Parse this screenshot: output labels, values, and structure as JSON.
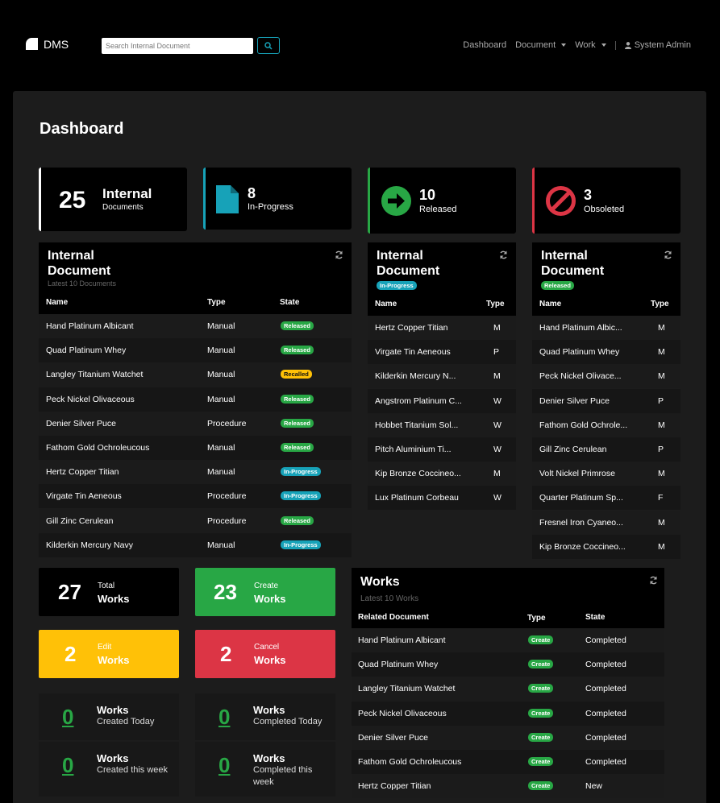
{
  "navbar": {
    "brand": "DMS",
    "search_placeholder": "Search Internal Document",
    "links": {
      "dashboard": "Dashboard",
      "document": "Document",
      "work": "Work",
      "user": "System Admin"
    }
  },
  "page_title": "Dashboard",
  "stats": [
    {
      "value": "25",
      "label1": "Internal",
      "label2": "Documents"
    },
    {
      "value": "8",
      "label": "In-Progress"
    },
    {
      "value": "10",
      "label": "Released"
    },
    {
      "value": "3",
      "label": "Obsoleted"
    }
  ],
  "internal_documents": {
    "title": "Internal Document",
    "subtitle": "Latest 10 Documents",
    "columns": [
      "Name",
      "Type",
      "State"
    ],
    "rows": [
      {
        "name": "Hand Platinum Albicant",
        "type": "Manual",
        "state": "Released"
      },
      {
        "name": "Quad Platinum Whey",
        "type": "Manual",
        "state": "Released"
      },
      {
        "name": "Langley Titanium Watchet",
        "type": "Manual",
        "state": "Recalled"
      },
      {
        "name": "Peck Nickel Olivaceous",
        "type": "Manual",
        "state": "Released"
      },
      {
        "name": "Denier Silver Puce",
        "type": "Procedure",
        "state": "Released"
      },
      {
        "name": "Fathom Gold Ochroleucous",
        "type": "Manual",
        "state": "Released"
      },
      {
        "name": "Hertz Copper Titian",
        "type": "Manual",
        "state": "In-Progress"
      },
      {
        "name": "Virgate Tin Aeneous",
        "type": "Procedure",
        "state": "In-Progress"
      },
      {
        "name": "Gill Zinc Cerulean",
        "type": "Procedure",
        "state": "Released"
      },
      {
        "name": "Kilderkin Mercury Navy",
        "type": "Manual",
        "state": "In-Progress"
      }
    ]
  },
  "inprogress_documents": {
    "title": "Internal Document",
    "badge": "In-Progress",
    "columns": [
      "Name",
      "Type"
    ],
    "rows": [
      {
        "name": "Hertz Copper Titian",
        "type": "M"
      },
      {
        "name": "Virgate Tin Aeneous",
        "type": "P"
      },
      {
        "name": "Kilderkin Mercury N...",
        "type": "M"
      },
      {
        "name": "Angstrom Platinum C...",
        "type": "W"
      },
      {
        "name": "Hobbet Titanium Sol...",
        "type": "W"
      },
      {
        "name": "Pitch Aluminium Ti...",
        "type": "W"
      },
      {
        "name": "Kip Bronze Coccineo...",
        "type": "M"
      },
      {
        "name": "Lux Platinum Corbeau",
        "type": "W"
      }
    ]
  },
  "released_documents": {
    "title": "Internal Document",
    "badge": "Released",
    "columns": [
      "Name",
      "Type"
    ],
    "rows": [
      {
        "name": "Hand Platinum Albic...",
        "type": "M"
      },
      {
        "name": "Quad Platinum Whey",
        "type": "M"
      },
      {
        "name": "Peck Nickel Olivace...",
        "type": "M"
      },
      {
        "name": "Denier Silver Puce",
        "type": "P"
      },
      {
        "name": "Fathom Gold Ochrole...",
        "type": "M"
      },
      {
        "name": "Gill Zinc Cerulean",
        "type": "P"
      },
      {
        "name": "Volt Nickel Primrose",
        "type": "M"
      },
      {
        "name": "Quarter Platinum Sp...",
        "type": "F"
      },
      {
        "name": "Fresnel Iron Cyaneo...",
        "type": "M"
      },
      {
        "name": "Kip Bronze Coccineo...",
        "type": "M"
      }
    ]
  },
  "work_cards": [
    {
      "value": "27",
      "label1": "Total",
      "label2": "Works",
      "color": "#000000"
    },
    {
      "value": "23",
      "label1": "Create",
      "label2": "Works",
      "color": "#28a745"
    },
    {
      "value": "2",
      "label1": "Edit",
      "label2": "Works",
      "color": "#ffc107"
    },
    {
      "value": "2",
      "label1": "Cancel",
      "label2": "Works",
      "color": "#dc3545"
    }
  ],
  "work_summary": [
    {
      "value": "0",
      "title": "Works",
      "subtitle": "Created Today"
    },
    {
      "value": "0",
      "title": "Works",
      "subtitle": "Completed Today"
    },
    {
      "value": "0",
      "title": "Works",
      "subtitle": "Created this week"
    },
    {
      "value": "0",
      "title": "Works",
      "subtitle": "Completed this week"
    }
  ],
  "works": {
    "title": "Works",
    "subtitle": "Latest 10 Works",
    "columns": [
      "Related Document",
      "Type",
      "State"
    ],
    "rows": [
      {
        "doc": "Hand Platinum Albicant",
        "type": "Create",
        "state": "Completed"
      },
      {
        "doc": "Quad Platinum Whey",
        "type": "Create",
        "state": "Completed"
      },
      {
        "doc": "Langley Titanium Watchet",
        "type": "Create",
        "state": "Completed"
      },
      {
        "doc": "Peck Nickel Olivaceous",
        "type": "Create",
        "state": "Completed"
      },
      {
        "doc": "Denier Silver Puce",
        "type": "Create",
        "state": "Completed"
      },
      {
        "doc": "Fathom Gold Ochroleucous",
        "type": "Create",
        "state": "Completed"
      },
      {
        "doc": "Hertz Copper Titian",
        "type": "Create",
        "state": "New"
      }
    ]
  },
  "colors": {
    "success": "#28a745",
    "info": "#17a2b8",
    "warning": "#ffc107",
    "danger": "#dc3545"
  },
  "icons": {
    "brand": "folder-icon",
    "search": "search-icon",
    "user": "user-icon",
    "inprogress": "file-icon",
    "released": "arrow-right-circle-icon",
    "obsoleted": "ban-icon",
    "refresh": "refresh-icon"
  }
}
